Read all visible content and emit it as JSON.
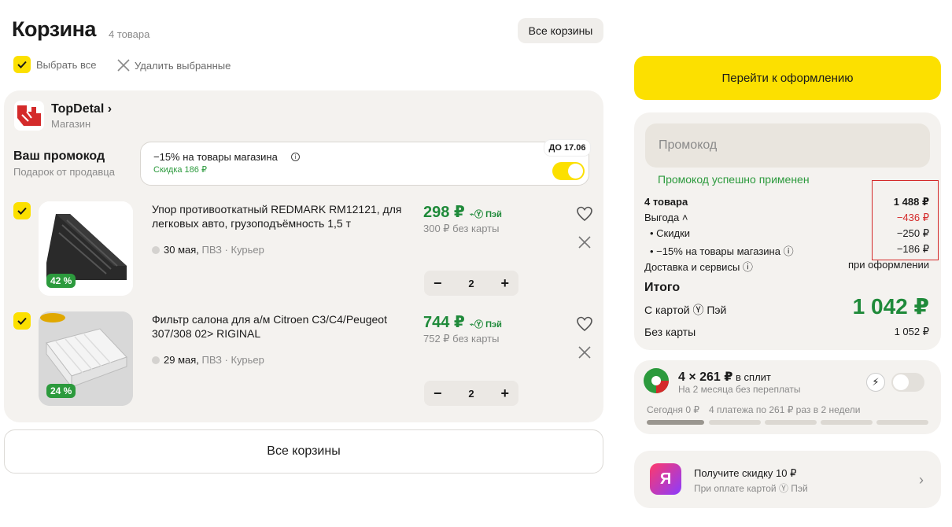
{
  "header": {
    "title": "Корзина",
    "count": "4 товара",
    "all_carts": "Все корзины"
  },
  "toolbar": {
    "select_all": "Выбрать все",
    "delete_selected": "Удалить выбранные"
  },
  "store": {
    "name": "TopDetal",
    "chevron": "›",
    "type": "Магазин",
    "promo": {
      "title": "Ваш промокод",
      "subtitle": "Подарок от продавца",
      "text": "−15% на товары магазина",
      "info": "i",
      "gift": "Скидка 186 ₽",
      "badge": "ДО 17.06",
      "enabled": true
    }
  },
  "items": [
    {
      "name": "Упор противооткатный REDMARK RM12121, для легковых авто, грузоподъёмность 1,5 т",
      "discount": "42 %",
      "date": "30 мая,",
      "delivery": " ПВЗ · Курьер",
      "price": "298 ₽",
      "pay": "⌁Ⓨ Пэй",
      "price_no_card": "300 ₽ без карты",
      "qty": "2",
      "minus": "−",
      "plus": "+"
    },
    {
      "name": "Фильтр салона для а/м Citroen C3/C4/Peugeot 307/308 02> RIGINAL",
      "discount": "24 %",
      "date": "29 мая,",
      "delivery": " ПВЗ · Курьер",
      "price": "744 ₽",
      "pay": "⌁Ⓨ Пэй",
      "price_no_card": "752 ₽ без карты",
      "qty": "2",
      "minus": "−",
      "plus": "+"
    }
  ],
  "bottom": {
    "all_carts": "Все корзины"
  },
  "summary": {
    "checkout": "Перейти к оформлению",
    "promo_placeholder": "Промокод",
    "promo_ok": "Промокод успешно применен",
    "goods_label": "4 товара",
    "goods_value": "1 488 ₽",
    "benefit_label": "Выгода ˄",
    "benefit_value": "−436 ₽",
    "discounts_label": "• Скидки",
    "discounts_value": "−250 ₽",
    "promo_label": "• −15% на товары магазина ⓘ",
    "promo_value": "−186 ₽",
    "delivery_label": "Доставка и сервисы ⓘ",
    "delivery_value": "при оформлении",
    "total_title": "Итого",
    "with_card_label": "С картой Ⓨ Пэй",
    "total": "1 042 ₽",
    "no_card_label": "Без карты",
    "no_card_value": "1 052 ₽"
  },
  "split": {
    "main": "4 × 261 ₽",
    "main_suffix": " в сплит",
    "sub": "На 2 месяца без переплаты",
    "today": "Сегодня 0 ₽",
    "plan": "4 платежа по 261 ₽ раз в 2 недели",
    "badge": "⚡",
    "enabled": false
  },
  "bank": {
    "logo": "Я",
    "main": "Получите скидку 10 ₽",
    "sub": "При оплате картой Ⓨ Пэй",
    "chevron": "›"
  },
  "colors": {
    "accent_yellow": "#fce000",
    "price_green": "#1f8a3a",
    "negative_red": "#d42a2a",
    "card_bg": "#f4f2ef"
  }
}
